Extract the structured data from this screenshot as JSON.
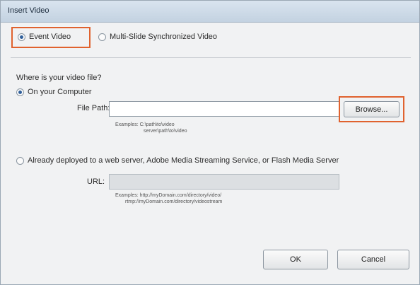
{
  "window": {
    "title": "Insert Video"
  },
  "video_type": {
    "event_video_label": "Event Video",
    "multi_slide_label": "Multi-Slide Synchronized Video",
    "selected": "event_video"
  },
  "source": {
    "question": "Where is your video file?",
    "on_computer_label": "On your Computer",
    "file_path_label": "File Path:",
    "file_path_value": "",
    "browse_label": "Browse...",
    "file_examples_1": "Examples: C:\\path\\to\\video",
    "file_examples_2": "server\\path\\to\\video",
    "web_server_label": "Already deployed to a web server, Adobe Media Streaming Service, or Flash Media Server",
    "url_label": "URL:",
    "url_value": "",
    "url_examples_1": "Examples: http://myDomain.com/directory/video/",
    "url_examples_2": "rtmp://myDomain.com/directory/videostream",
    "selected": "on_computer"
  },
  "buttons": {
    "ok_label": "OK",
    "cancel_label": "Cancel"
  },
  "colors": {
    "highlight": "#e0622e",
    "accent": "#2f5f9a"
  }
}
